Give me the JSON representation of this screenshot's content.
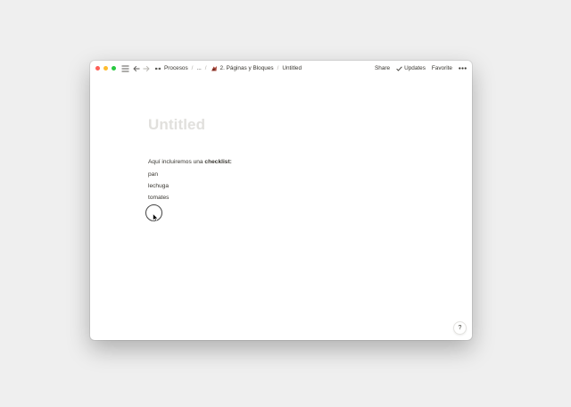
{
  "breadcrumb": {
    "workspace": "Procesos",
    "ellipsis": "...",
    "parent": "2. Páginas y Bloques",
    "current": "Untitled",
    "separator": "/"
  },
  "actions": {
    "share": "Share",
    "updates": "Updates",
    "favorite": "Favorite"
  },
  "page": {
    "title": "Untitled",
    "intro_text": "Aquí incluiremos una ",
    "intro_bold": "checklist:",
    "items": [
      "pan",
      "lechuga",
      "tomates"
    ]
  },
  "help": {
    "label": "?"
  },
  "colors": {
    "close": "#fe5f57",
    "minimize": "#febc2e",
    "zoom": "#28c840",
    "title_placeholder": "#e1e0dd",
    "text": "#37352f"
  },
  "icons": {
    "menu": "hamburger-menu-icon",
    "back": "arrow-left-icon",
    "forward": "arrow-right-icon",
    "workspace": "people-icon",
    "page": "page-emoji-icon",
    "updates": "checkmark-icon",
    "more": "ellipsis-icon",
    "cursor": "mouse-pointer-icon"
  }
}
